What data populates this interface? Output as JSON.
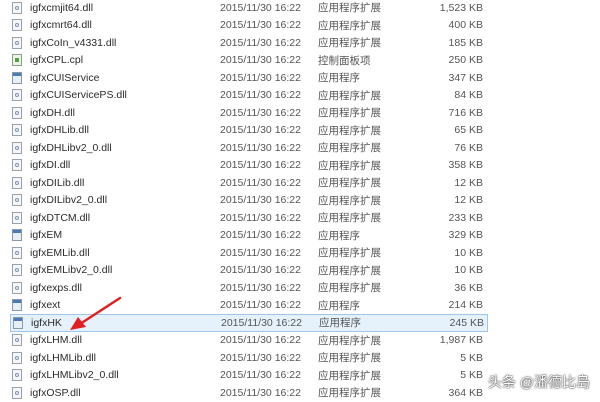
{
  "files": [
    {
      "name": "igfxcmjit64.dll",
      "date": "2015/11/30 16:22",
      "type": "应用程序扩展",
      "size": "1,523 KB",
      "icon": "dll-file-icon"
    },
    {
      "name": "igfxcmrt64.dll",
      "date": "2015/11/30 16:22",
      "type": "应用程序扩展",
      "size": "400 KB",
      "icon": "dll-file-icon"
    },
    {
      "name": "igfxCoIn_v4331.dll",
      "date": "2015/11/30 16:22",
      "type": "应用程序扩展",
      "size": "185 KB",
      "icon": "dll-file-icon"
    },
    {
      "name": "igfxCPL.cpl",
      "date": "2015/11/30 16:22",
      "type": "控制面板项",
      "size": "250 KB",
      "icon": "control-panel-icon"
    },
    {
      "name": "igfxCUIService",
      "date": "2015/11/30 16:22",
      "type": "应用程序",
      "size": "347 KB",
      "icon": "application-icon"
    },
    {
      "name": "igfxCUIServicePS.dll",
      "date": "2015/11/30 16:22",
      "type": "应用程序扩展",
      "size": "84 KB",
      "icon": "dll-file-icon"
    },
    {
      "name": "igfxDH.dll",
      "date": "2015/11/30 16:22",
      "type": "应用程序扩展",
      "size": "716 KB",
      "icon": "dll-file-icon"
    },
    {
      "name": "igfxDHLib.dll",
      "date": "2015/11/30 16:22",
      "type": "应用程序扩展",
      "size": "65 KB",
      "icon": "dll-file-icon"
    },
    {
      "name": "igfxDHLibv2_0.dll",
      "date": "2015/11/30 16:22",
      "type": "应用程序扩展",
      "size": "76 KB",
      "icon": "dll-file-icon"
    },
    {
      "name": "igfxDI.dll",
      "date": "2015/11/30 16:22",
      "type": "应用程序扩展",
      "size": "358 KB",
      "icon": "dll-file-icon"
    },
    {
      "name": "igfxDILib.dll",
      "date": "2015/11/30 16:22",
      "type": "应用程序扩展",
      "size": "12 KB",
      "icon": "dll-file-icon"
    },
    {
      "name": "igfxDILibv2_0.dll",
      "date": "2015/11/30 16:22",
      "type": "应用程序扩展",
      "size": "12 KB",
      "icon": "dll-file-icon"
    },
    {
      "name": "igfxDTCM.dll",
      "date": "2015/11/30 16:22",
      "type": "应用程序扩展",
      "size": "233 KB",
      "icon": "dll-file-icon"
    },
    {
      "name": "igfxEM",
      "date": "2015/11/30 16:22",
      "type": "应用程序",
      "size": "329 KB",
      "icon": "application-icon"
    },
    {
      "name": "igfxEMLib.dll",
      "date": "2015/11/30 16:22",
      "type": "应用程序扩展",
      "size": "10 KB",
      "icon": "dll-file-icon"
    },
    {
      "name": "igfxEMLibv2_0.dll",
      "date": "2015/11/30 16:22",
      "type": "应用程序扩展",
      "size": "10 KB",
      "icon": "dll-file-icon"
    },
    {
      "name": "igfxexps.dll",
      "date": "2015/11/30 16:22",
      "type": "应用程序扩展",
      "size": "36 KB",
      "icon": "dll-file-icon"
    },
    {
      "name": "igfxext",
      "date": "2015/11/30 16:22",
      "type": "应用程序",
      "size": "214 KB",
      "icon": "application-icon"
    },
    {
      "name": "igfxHK",
      "date": "2015/11/30 16:22",
      "type": "应用程序",
      "size": "245 KB",
      "icon": "application-icon",
      "selected": true
    },
    {
      "name": "igfxLHM.dll",
      "date": "2015/11/30 16:22",
      "type": "应用程序扩展",
      "size": "1,987 KB",
      "icon": "dll-file-icon"
    },
    {
      "name": "igfxLHMLib.dll",
      "date": "2015/11/30 16:22",
      "type": "应用程序扩展",
      "size": "5 KB",
      "icon": "dll-file-icon"
    },
    {
      "name": "igfxLHMLibv2_0.dll",
      "date": "2015/11/30 16:22",
      "type": "应用程序扩展",
      "size": "5 KB",
      "icon": "dll-file-icon"
    },
    {
      "name": "igfxOSP.dll",
      "date": "2015/11/30 16:22",
      "type": "应用程序扩展",
      "size": "364 KB",
      "icon": "dll-file-icon"
    }
  ],
  "annotation": {
    "arrow_color": "#e02020",
    "arrow_icon": "red-arrow-icon"
  },
  "watermark": {
    "text": "头条 @潘德比岛"
  }
}
